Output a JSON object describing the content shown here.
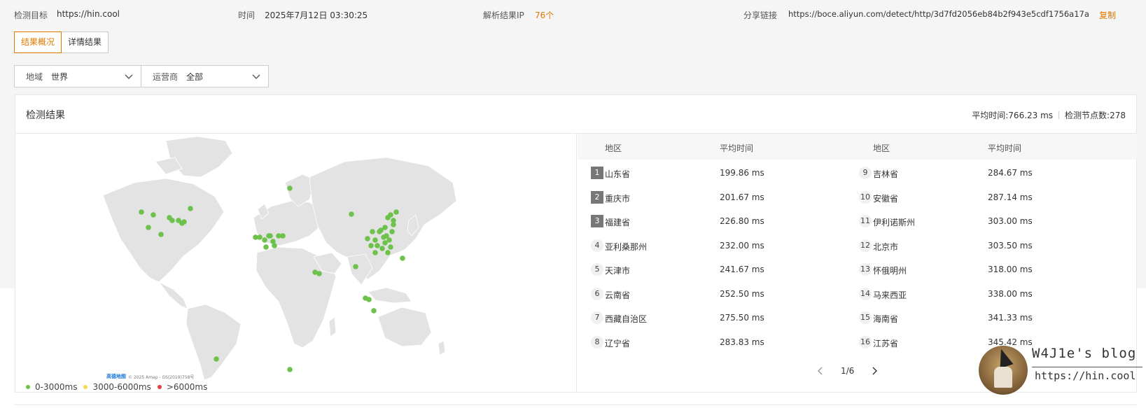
{
  "header": {
    "target_label": "检测目标",
    "target_value": "https://hin.cool",
    "time_label": "时间",
    "time_value": "2025年7月12日 03:30:25",
    "ip_label": "解析结果IP",
    "ip_value": "76个",
    "share_label": "分享链接",
    "share_url": "https://boce.aliyun.com/detect/http/3d7fd2056eb84b2f943e5cdf1756a17a",
    "copy_label": "复制"
  },
  "tabs": [
    {
      "label": "结果概况",
      "active": true
    },
    {
      "label": "详情结果",
      "active": false
    }
  ],
  "filters": {
    "region": {
      "label": "地域",
      "value": "世界"
    },
    "carrier": {
      "label": "运营商",
      "value": "全部"
    }
  },
  "results": {
    "title": "检测结果",
    "avg_time": "平均时间:766.23 ms",
    "node_count": "检测节点数:278"
  },
  "map": {
    "attribution_brand": "高德地图",
    "attribution_text": "© 2025 Amap - GS(2019)758号",
    "legend": [
      {
        "label": "0-3000ms",
        "color": "#6cc24a"
      },
      {
        "label": "3000-6000ms",
        "color": "#f5d94e"
      },
      {
        "label": ">6000ms",
        "color": "#e04040"
      }
    ]
  },
  "table": {
    "col_region": "地区",
    "col_time": "平均时间",
    "left": [
      {
        "rank": "1",
        "region": "山东省",
        "time": "199.86 ms"
      },
      {
        "rank": "2",
        "region": "重庆市",
        "time": "201.67 ms"
      },
      {
        "rank": "3",
        "region": "福建省",
        "time": "226.80 ms"
      },
      {
        "rank": "4",
        "region": "亚利桑那州",
        "time": "232.00 ms"
      },
      {
        "rank": "5",
        "region": "天津市",
        "time": "241.67 ms"
      },
      {
        "rank": "6",
        "region": "云南省",
        "time": "252.50 ms"
      },
      {
        "rank": "7",
        "region": "西藏自治区",
        "time": "275.50 ms"
      },
      {
        "rank": "8",
        "region": "辽宁省",
        "time": "283.83 ms"
      }
    ],
    "right": [
      {
        "rank": "9",
        "region": "吉林省",
        "time": "284.67 ms"
      },
      {
        "rank": "10",
        "region": "安徽省",
        "time": "287.14 ms"
      },
      {
        "rank": "11",
        "region": "伊利诺斯州",
        "time": "303.00 ms"
      },
      {
        "rank": "12",
        "region": "北京市",
        "time": "303.50 ms"
      },
      {
        "rank": "13",
        "region": "怀俄明州",
        "time": "318.00 ms"
      },
      {
        "rank": "14",
        "region": "马来西亚",
        "time": "338.00 ms"
      },
      {
        "rank": "15",
        "region": "海南省",
        "time": "341.33 ms"
      },
      {
        "rank": "16",
        "region": "江苏省",
        "time": "345.42 ms"
      }
    ],
    "page": "1/6"
  },
  "watermark": {
    "title": "W4J1e's blog",
    "url": "https://hin.cool"
  }
}
